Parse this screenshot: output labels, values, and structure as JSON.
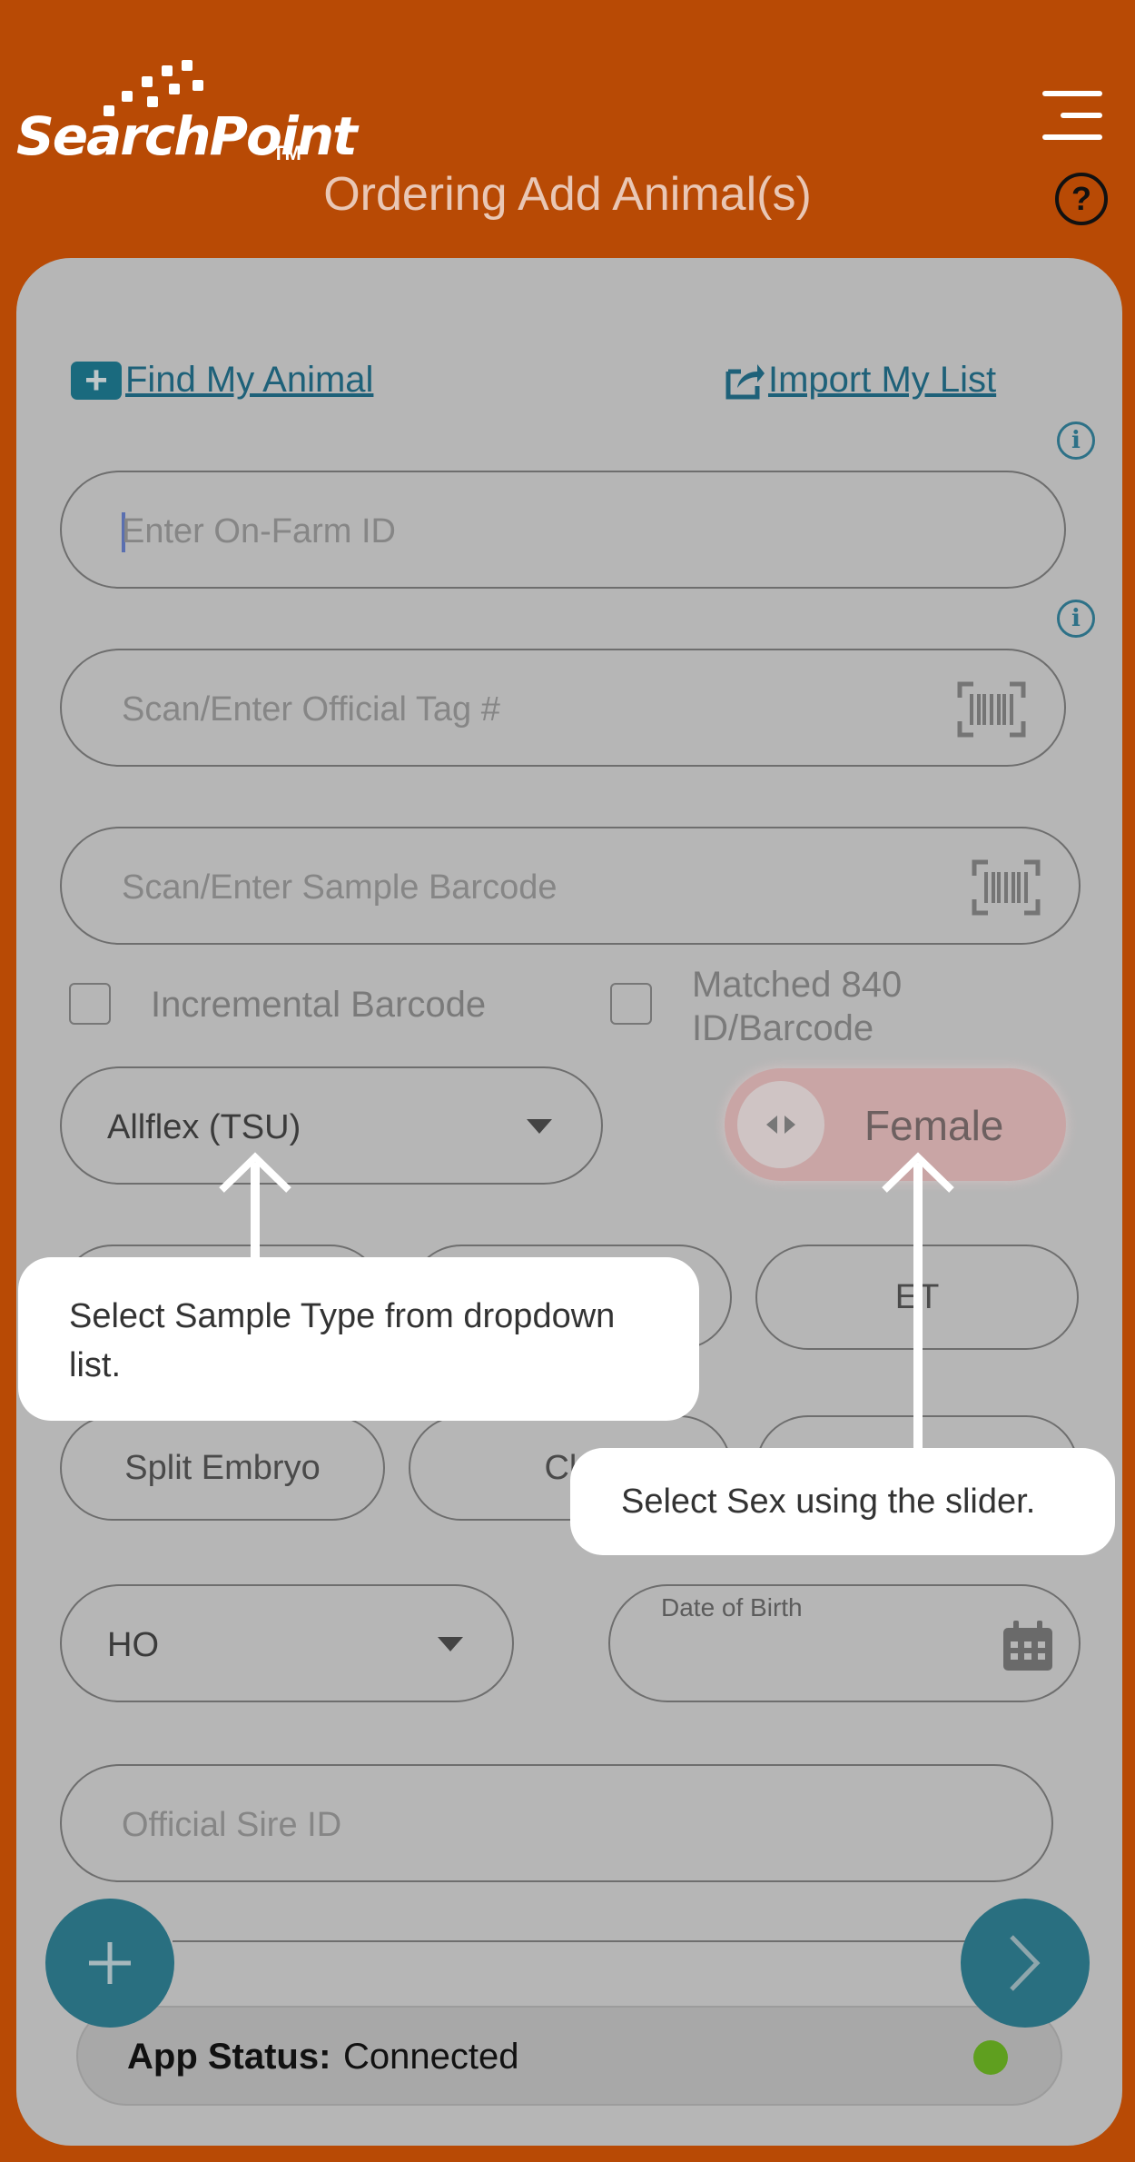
{
  "header": {
    "logo_text": "SearchPoint",
    "logo_tm": "TM",
    "title": "Ordering Add Animal(s)",
    "menu_icon": "hamburger-menu-icon",
    "help_label": "?"
  },
  "links": {
    "find_animal": "Find My Animal",
    "import_list": "Import My List"
  },
  "form": {
    "on_farm_id_placeholder": "Enter On-Farm ID",
    "official_tag_placeholder": "Scan/Enter Official Tag #",
    "sample_barcode_placeholder": "Scan/Enter Sample Barcode",
    "incremental_barcode_label": "Incremental Barcode",
    "matched_label_line1": "Matched 840",
    "matched_label_line2": "ID/Barcode",
    "sample_type_value": "Allflex (TSU)",
    "sex_value": "Female",
    "chips": [
      "ET",
      "Split Embryo",
      "Clo"
    ],
    "breed_value": "HO",
    "dob_label": "Date of Birth",
    "sire_placeholder": "Official Sire ID"
  },
  "tooltips": {
    "sample_type": "Select Sample Type from dropdown list.",
    "sex": "Select Sex using the slider."
  },
  "status": {
    "label": "App Status:",
    "value": "Connected",
    "indicator_color": "#5f9f1f"
  },
  "colors": {
    "brand_orange": "#b84a05",
    "teal": "#296f80"
  }
}
